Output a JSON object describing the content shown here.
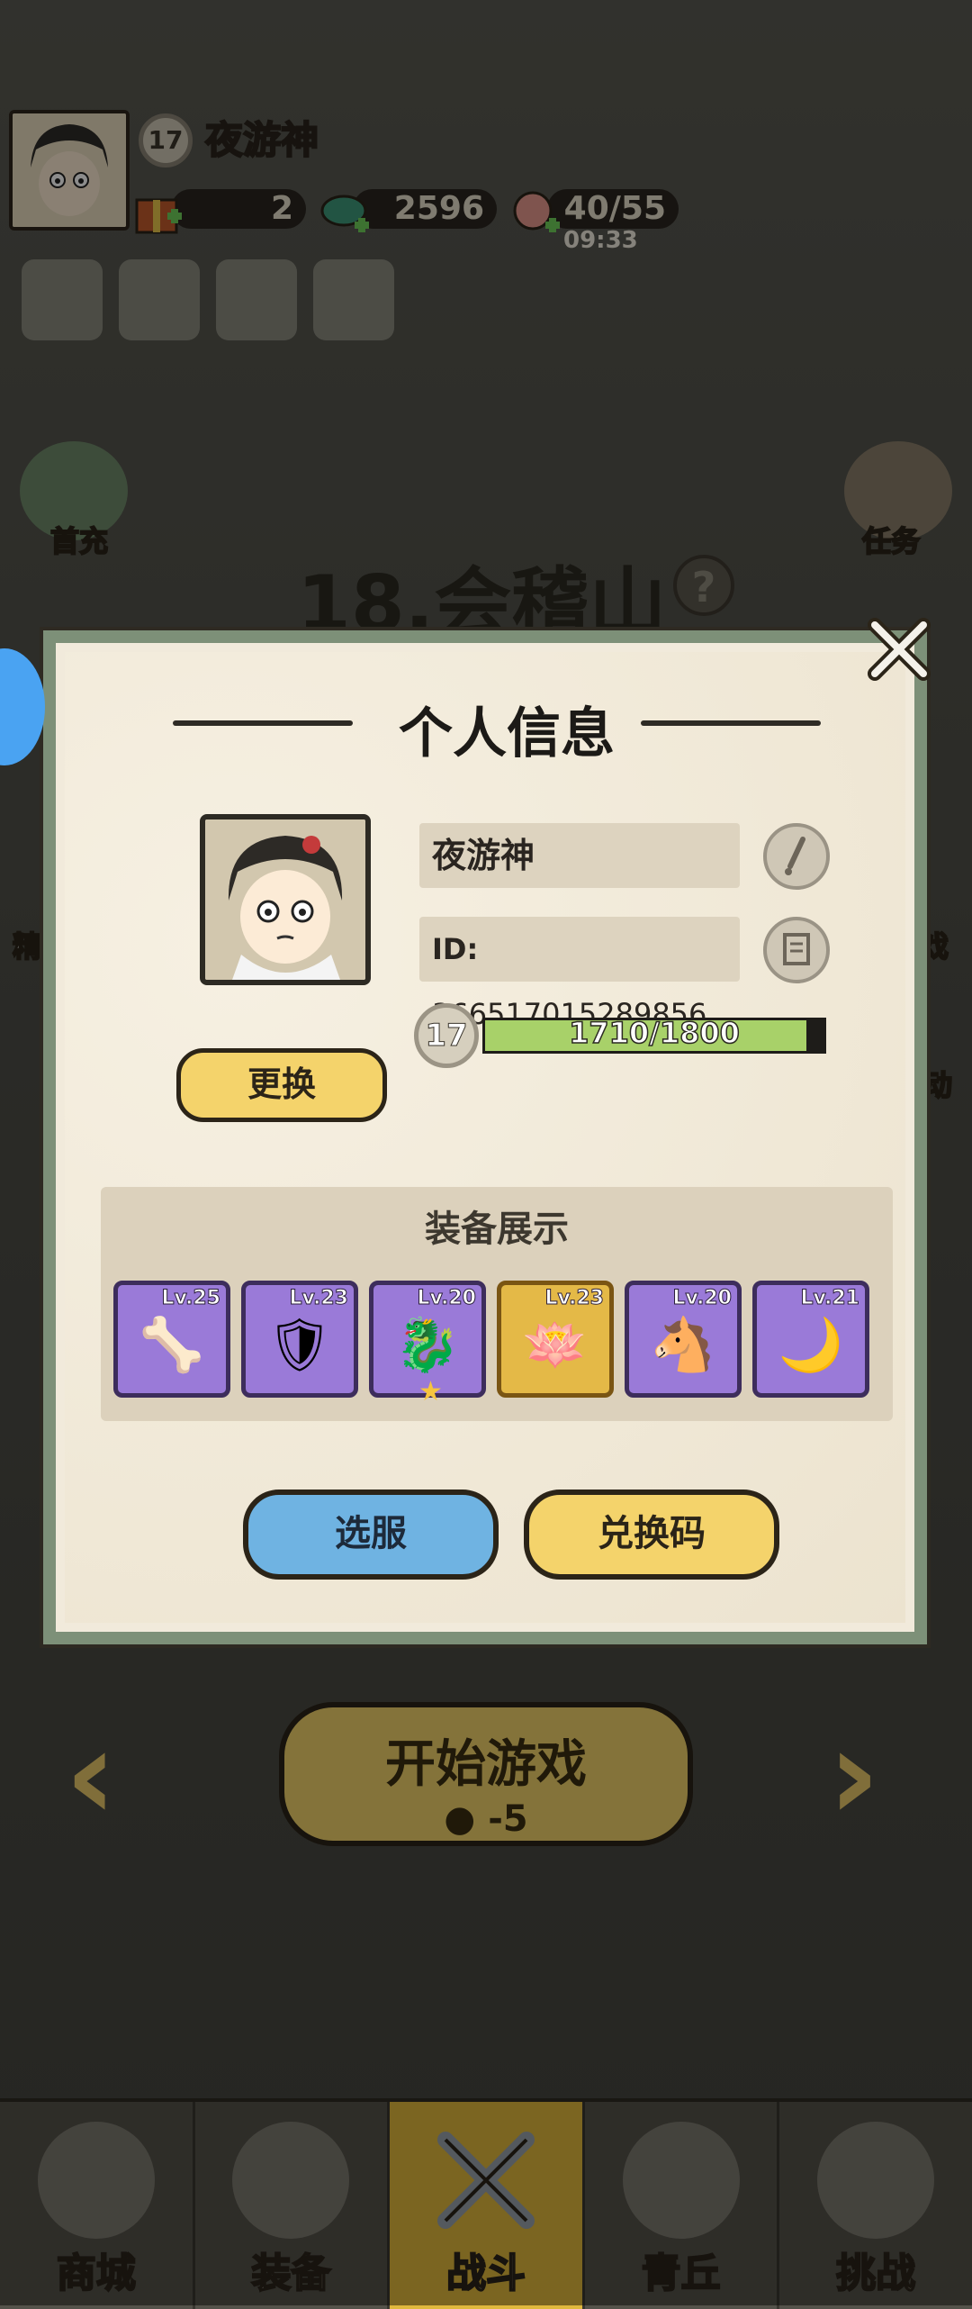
{
  "player": {
    "name": "夜游神",
    "level": "17",
    "id_label": "ID:",
    "id_value": "366517015289856",
    "xp_text": "1710/1800",
    "xp_fraction": 0.95
  },
  "resources": {
    "gift_count": "2",
    "coin_count": "2596",
    "stamina": "40/55",
    "stamina_timer": "09:33"
  },
  "side_menu": {
    "left_top": "首充",
    "right_top": "任务",
    "left_mid": "精",
    "right_mid": "戏",
    "right_low": "动"
  },
  "stage": {
    "title": "18.会稽山",
    "help": "?"
  },
  "start": {
    "label": "开始游戏",
    "cost": "-5"
  },
  "modal": {
    "title": "个人信息",
    "change_label": "更换",
    "equipment_title": "装备展示",
    "server_label": "选服",
    "code_label": "兑换码"
  },
  "equipment": [
    {
      "level": "Lv.25",
      "rarity": "purple",
      "icon": "bone-ornament-icon"
    },
    {
      "level": "Lv.23",
      "rarity": "purple",
      "icon": "winged-armor-icon"
    },
    {
      "level": "Lv.20",
      "rarity": "purple",
      "icon": "serpent-blade-icon",
      "star": true
    },
    {
      "level": "Lv.23",
      "rarity": "gold",
      "icon": "lotus-belt-icon"
    },
    {
      "level": "Lv.20",
      "rarity": "purple",
      "icon": "horse-mask-icon"
    },
    {
      "level": "Lv.21",
      "rarity": "purple",
      "icon": "horn-ornament-icon"
    }
  ],
  "nav": [
    {
      "label": "商城",
      "icon": "shop-icon"
    },
    {
      "label": "装备",
      "icon": "helmet-icon"
    },
    {
      "label": "战斗",
      "icon": "crossed-swords-icon",
      "active": true
    },
    {
      "label": "青丘",
      "icon": "mountain-icon"
    },
    {
      "label": "挑战",
      "icon": "orb-icon"
    }
  ],
  "colors": {
    "modal_border": "#7d9078",
    "xp_fill": "#a8d169",
    "button_yellow": "#f4d36b",
    "button_blue": "#6fb3e2",
    "equip_purple": "#9a7ad8",
    "equip_gold": "#e4b947",
    "nav_active": "#e0b83d"
  }
}
